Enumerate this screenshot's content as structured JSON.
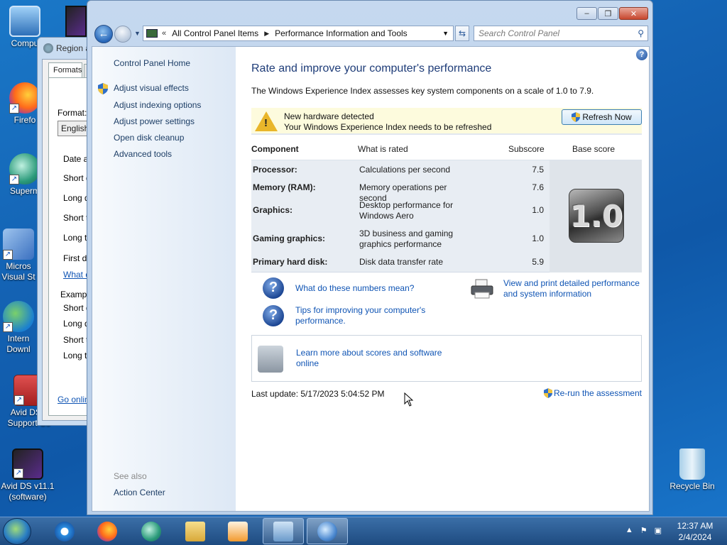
{
  "desktop": {
    "icons": [
      {
        "label": "Compu",
        "name": "computer"
      },
      {
        "label": "Firefo",
        "name": "firefox"
      },
      {
        "label": "Superm",
        "name": "supermium"
      },
      {
        "label": "Micros Visual St",
        "name": "visual-studio"
      },
      {
        "label": "Intern Downl",
        "name": "internet-download-manager"
      },
      {
        "label": "Avid DS v Support Co",
        "name": "avid-support"
      },
      {
        "label": "Avid DS v11.1 (software)",
        "name": "avid-ds"
      },
      {
        "label": "Recycle Bin",
        "name": "recycle-bin"
      }
    ]
  },
  "region_window": {
    "title": "Region a",
    "tab": "Formats",
    "format_label": "Format:",
    "format_value": "English",
    "rows": [
      "Date a",
      "Short d",
      "Long d",
      "Short t",
      "Long t",
      "First d"
    ],
    "link": "What d",
    "example_label": "Examp",
    "examples": [
      "Short d",
      "Long d",
      "Short t",
      "Long t"
    ],
    "online_link": "Go onlin"
  },
  "window": {
    "breadcrumb": [
      "All Control Panel Items",
      "Performance Information and Tools"
    ],
    "search_placeholder": "Search Control Panel",
    "left_pane": {
      "home": "Control Panel Home",
      "links": [
        "Adjust visual effects",
        "Adjust indexing options",
        "Adjust power settings",
        "Open disk cleanup",
        "Advanced tools"
      ],
      "see_also": "See also",
      "action_center": "Action Center"
    },
    "title": "Rate and improve your computer's performance",
    "description": "The Windows Experience Index assesses key system components on a scale of 1.0 to 7.9.",
    "notice": {
      "line1": "New hardware detected",
      "line2": "Your Windows Experience Index needs to be refreshed",
      "button": "Refresh Now"
    },
    "table": {
      "headers": [
        "Component",
        "What is rated",
        "Subscore",
        "Base score"
      ],
      "rows": [
        {
          "component": "Processor:",
          "rated": "Calculations per second",
          "subscore": "7.5"
        },
        {
          "component": "Memory (RAM):",
          "rated": "Memory operations per second",
          "subscore": "7.6"
        },
        {
          "component": "Graphics:",
          "rated": "Desktop performance for Windows Aero",
          "subscore": "1.0"
        },
        {
          "component": "Gaming graphics:",
          "rated": "3D business and gaming graphics performance",
          "subscore": "1.0"
        },
        {
          "component": "Primary hard disk:",
          "rated": "Disk data transfer rate",
          "subscore": "5.9"
        }
      ],
      "base_score": "1.0"
    },
    "links": {
      "numbers": "What do these numbers mean?",
      "tips": "Tips for improving your computer's performance.",
      "print": "View and print detailed performance and system information",
      "learn": "Learn more about scores and software online"
    },
    "last_update": "Last update: 5/17/2023 5:04:52 PM",
    "rerun": "Re-run the assessment"
  },
  "taskbar": {
    "time": "12:37 AM",
    "date": "2/4/2024"
  },
  "colors": {
    "link": "#0f54b4",
    "title": "#1e3c78",
    "notice_bg": "#fdfbdd",
    "desktop": "#1463b4"
  }
}
